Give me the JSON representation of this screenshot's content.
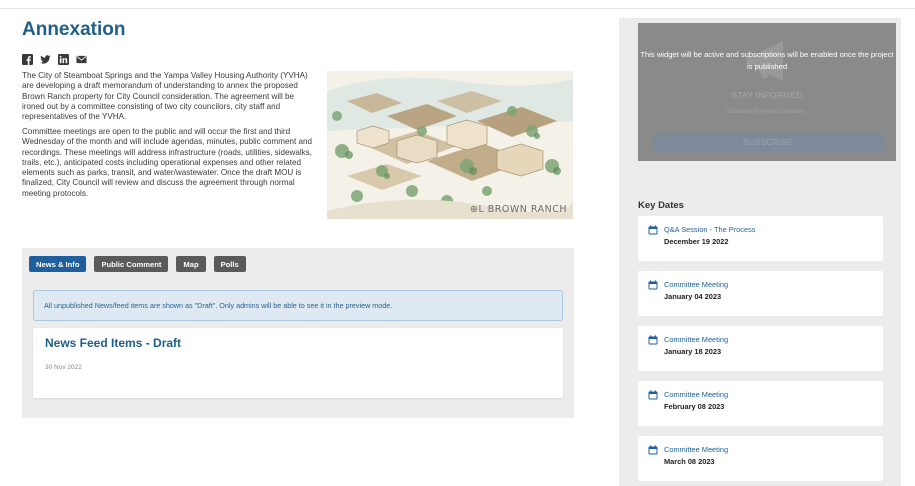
{
  "page": {
    "title": "Annexation",
    "social": [
      "facebook-icon",
      "twitter-icon",
      "linkedin-icon",
      "email-icon"
    ],
    "intro_paragraphs": [
      "The City of Steamboat Springs and the Yampa Valley Housing Authority (YVHA) are developing a draft memorandum of understanding to annex the proposed Brown Ranch property for City Council consideration. The agreement will be ironed out by a committee consisting of two city councilors, city staff and representatives of the YVHA.",
      "Committee meetings are open to the public and will occur the first and third Wednesday of the month and will include agendas, minutes, public comment and recordings. These meetings will address infrastructure (roads, utilities, sidewalks, trails, etc.), anticipated costs including operational expenses and other related elements such as parks, transit, and water/wastewater. Once the draft MOU is finalized, City Council will review and discuss the agreement through normal meeting protocols."
    ],
    "hero_logo": "BROWN RANCH"
  },
  "tabs": [
    {
      "label": "News & Info",
      "active": true
    },
    {
      "label": "Public Comment",
      "active": false
    },
    {
      "label": "Map",
      "active": false
    },
    {
      "label": "Polls",
      "active": false
    }
  ],
  "notice": "All unpublished News/feed items are shown as \"Draft\". Only admins will be able to see it in the preview mode.",
  "feed": {
    "title": "News Feed Items - Draft",
    "date": "30 Nov 2022"
  },
  "widget": {
    "message": "This widget will be active and subscriptions will be enabled once the project is published",
    "stay_informed": "STAY INFORMED",
    "subtitle": "Subscribe for project updates -",
    "button": "SUBSCRIBE"
  },
  "key_dates": {
    "title": "Key Dates",
    "items": [
      {
        "name": "Q&A Session - The Process",
        "date": "December 19 2022"
      },
      {
        "name": "Committee Meeting",
        "date": "January 04 2023"
      },
      {
        "name": "Committee Meeting",
        "date": "January 18 2023"
      },
      {
        "name": "Committee Meeting",
        "date": "February 08 2023"
      },
      {
        "name": "Committee Meeting",
        "date": "March 08 2023"
      }
    ]
  },
  "colors": {
    "accent": "#1f5f9e",
    "title": "#1f5f8b",
    "panel": "#ececec",
    "widget": "#8a8a8a"
  }
}
